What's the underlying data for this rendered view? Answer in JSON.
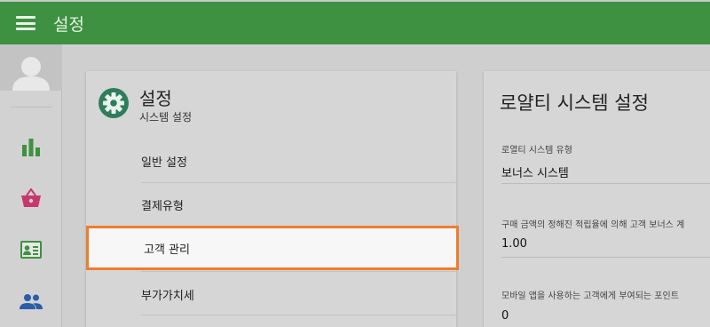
{
  "header": {
    "title": "설정",
    "background": "#3d9140"
  },
  "rail": {
    "items": [
      {
        "name": "reports",
        "icon": "bar-chart-icon",
        "color": "#3d9140"
      },
      {
        "name": "sales",
        "icon": "basket-icon",
        "color": "#c8376c"
      },
      {
        "name": "customers",
        "icon": "contact-card-icon",
        "color": "#3d9140"
      },
      {
        "name": "employees",
        "icon": "people-icon",
        "color": "#2a5ca8"
      }
    ]
  },
  "settings_card": {
    "title": "설정",
    "subtitle": "시스템 설정",
    "menu": [
      {
        "label": "일반 설정"
      },
      {
        "label": "결제유형"
      },
      {
        "label": "고객 관리",
        "selected": true
      },
      {
        "label": "부가가치세"
      }
    ]
  },
  "loyalty_card": {
    "title": "로얄티 시스템 설정",
    "fields": [
      {
        "label": "로열티 시스템 유형",
        "value": "보너스 시스템"
      },
      {
        "label": "구매 금액의 정해진 적립율에 의해 고객 보너스 계",
        "value": "1.00"
      },
      {
        "label": "모바일 앱을 사용하는 고객에게 부여되는 포인트",
        "value": "0"
      }
    ]
  },
  "colors": {
    "accent": "#3d9140",
    "highlight_border": "#ef7d2c"
  }
}
